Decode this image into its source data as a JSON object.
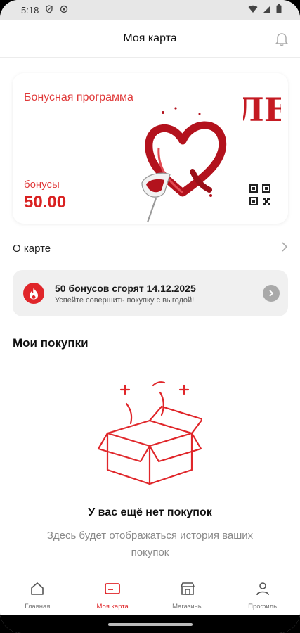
{
  "status": {
    "time": "5:18"
  },
  "header": {
    "title": "Моя карта"
  },
  "card": {
    "program_label": "Бонусная программа",
    "bonus_label": "бонусы",
    "bonus_value": "50.00",
    "logo_text": "ЛЕ"
  },
  "about": {
    "label": "О карте"
  },
  "promo": {
    "title": "50 бонусов сгорят 14.12.2025",
    "subtitle": "Успейте совершить покупку с выгодой!"
  },
  "purchases": {
    "section_title": "Мои покупки",
    "empty_title": "У вас ещё нет покупок",
    "empty_subtitle": "Здесь будет отображаться история ваших покупок"
  },
  "tabs": [
    {
      "label": "Главная",
      "icon": "home-icon"
    },
    {
      "label": "Моя карта",
      "icon": "card-icon",
      "active": true
    },
    {
      "label": "Магазины",
      "icon": "store-icon"
    },
    {
      "label": "Профиль",
      "icon": "profile-icon"
    }
  ],
  "colors": {
    "accent": "#e0262a",
    "promo_bg": "#f0f0f0"
  }
}
